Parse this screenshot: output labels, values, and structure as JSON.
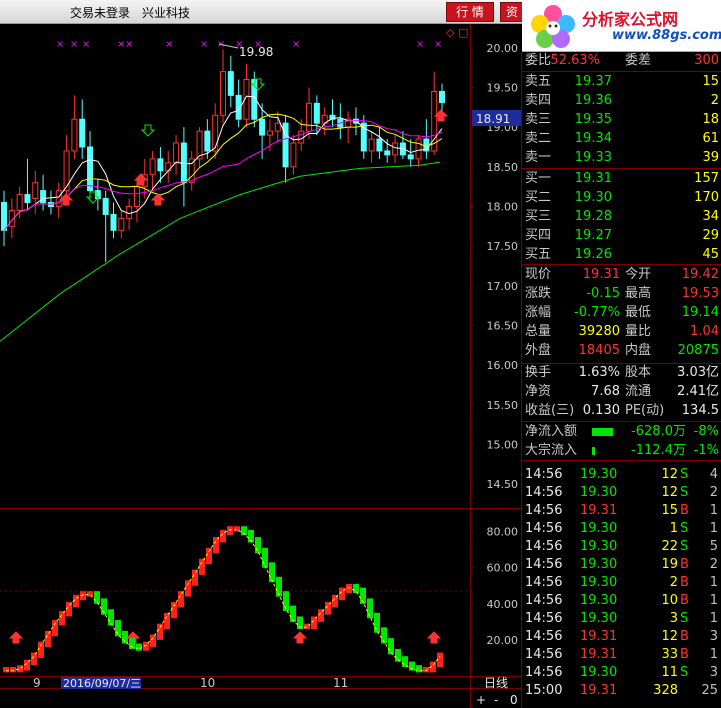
{
  "titlebar": {
    "status": "交易未登录",
    "stock_name": "兴业科技",
    "btn_quote": "行 情",
    "btn_info": "资"
  },
  "logo": {
    "brand": "分析家公式网",
    "url": "www.88gs.com"
  },
  "price_panel": {
    "max_label": "19.98",
    "current_label": "18.91",
    "axis_labels": [
      "20.00",
      "19.50",
      "19.00",
      "18.50",
      "18.00",
      "17.50",
      "17.00",
      "16.50",
      "16.00",
      "15.50",
      "15.00",
      "14.50"
    ],
    "axis_values": [
      20.0,
      19.5,
      19.0,
      18.5,
      18.0,
      17.5,
      17.0,
      16.5,
      16.0,
      15.5,
      15.0,
      14.5
    ]
  },
  "indicator_panel": {
    "axis_labels": [
      "80.00",
      "60.00",
      "40.00",
      "20.00"
    ],
    "axis_values": [
      80,
      60,
      40,
      20
    ]
  },
  "time_axis": {
    "labels": [
      "9",
      "10",
      "11"
    ],
    "cursor_date": "2016/09/07/三",
    "period": "日线",
    "zoom_in": "+",
    "zoom_out": "-",
    "zero": "0"
  },
  "quote": {
    "ratio_label": "委比",
    "ratio_value": "52.63%",
    "diff_label": "委差",
    "diff_value": "300",
    "sell": [
      {
        "label": "卖五",
        "price": "19.37",
        "vol": "15"
      },
      {
        "label": "卖四",
        "price": "19.36",
        "vol": "2"
      },
      {
        "label": "卖三",
        "price": "19.35",
        "vol": "18"
      },
      {
        "label": "卖二",
        "price": "19.34",
        "vol": "61"
      },
      {
        "label": "卖一",
        "price": "19.33",
        "vol": "39"
      }
    ],
    "buy": [
      {
        "label": "买一",
        "price": "19.31",
        "vol": "157"
      },
      {
        "label": "买二",
        "price": "19.30",
        "vol": "170"
      },
      {
        "label": "买三",
        "price": "19.28",
        "vol": "34"
      },
      {
        "label": "买四",
        "price": "19.27",
        "vol": "29"
      },
      {
        "label": "买五",
        "price": "19.26",
        "vol": "45"
      }
    ],
    "stats": [
      {
        "l1": "现价",
        "v1": "19.31",
        "c1": "red",
        "l2": "今开",
        "v2": "19.42",
        "c2": "red"
      },
      {
        "l1": "涨跌",
        "v1": "-0.15",
        "c1": "green",
        "l2": "最高",
        "v2": "19.53",
        "c2": "red"
      },
      {
        "l1": "涨幅",
        "v1": "-0.77%",
        "c1": "green",
        "l2": "最低",
        "v2": "19.14",
        "c2": "green"
      },
      {
        "l1": "总量",
        "v1": "39280",
        "c1": "yellow",
        "l2": "量比",
        "v2": "1.04",
        "c2": "red"
      },
      {
        "l1": "外盘",
        "v1": "18405",
        "c1": "red",
        "l2": "内盘",
        "v2": "20875",
        "c2": "green"
      }
    ],
    "fund": [
      {
        "l1": "换手",
        "v1": "1.63%",
        "l2": "股本",
        "v2": "3.03亿"
      },
      {
        "l1": "净资",
        "v1": "7.68",
        "l2": "流通",
        "v2": "2.41亿"
      },
      {
        "l1": "收益(三)",
        "v1": "0.130",
        "l2": "PE(动)",
        "v2": "134.5"
      }
    ],
    "flow": [
      {
        "label": "净流入额",
        "value": "-628.0万",
        "pct": "-8%",
        "bar": 0.8
      },
      {
        "label": "大宗流入",
        "value": "-112.4万",
        "pct": "-1%",
        "bar": 0.1
      }
    ]
  },
  "ticks": [
    {
      "time": "14:56",
      "price": "19.30",
      "vol": "12",
      "side": "S",
      "n": "4"
    },
    {
      "time": "14:56",
      "price": "19.30",
      "vol": "12",
      "side": "S",
      "n": "2"
    },
    {
      "time": "14:56",
      "price": "19.31",
      "vol": "15",
      "side": "B",
      "n": "1"
    },
    {
      "time": "14:56",
      "price": "19.30",
      "vol": "1",
      "side": "S",
      "n": "1"
    },
    {
      "time": "14:56",
      "price": "19.30",
      "vol": "22",
      "side": "S",
      "n": "5"
    },
    {
      "time": "14:56",
      "price": "19.30",
      "vol": "19",
      "side": "B",
      "n": "2"
    },
    {
      "time": "14:56",
      "price": "19.30",
      "vol": "2",
      "side": "B",
      "n": "1"
    },
    {
      "time": "14:56",
      "price": "19.30",
      "vol": "10",
      "side": "B",
      "n": "1"
    },
    {
      "time": "14:56",
      "price": "19.30",
      "vol": "3",
      "side": "S",
      "n": "1"
    },
    {
      "time": "14:56",
      "price": "19.31",
      "vol": "12",
      "side": "B",
      "n": "3"
    },
    {
      "time": "14:56",
      "price": "19.31",
      "vol": "33",
      "side": "B",
      "n": "1"
    },
    {
      "time": "14:56",
      "price": "19.30",
      "vol": "11",
      "side": "S",
      "n": "3"
    },
    {
      "time": "15:00",
      "price": "19.31",
      "vol": "328",
      "side": "",
      "n": "25"
    }
  ],
  "colors": {
    "up": "#ff3232",
    "down": "#54ffff",
    "ma_white": "#ffffff",
    "ma_yellow": "#ffff00",
    "ma_magenta": "#ff00ff",
    "ma_green": "#00e600",
    "grid": "#7a0000",
    "axis_text": "#c8c8c8"
  },
  "chart_data": {
    "type": "candlestick",
    "candles": [
      {
        "o": 18.05,
        "h": 18.2,
        "l": 17.5,
        "c": 17.7
      },
      {
        "o": 17.75,
        "h": 18.1,
        "l": 17.6,
        "c": 17.95
      },
      {
        "o": 17.95,
        "h": 18.25,
        "l": 17.85,
        "c": 18.15
      },
      {
        "o": 18.15,
        "h": 18.6,
        "l": 17.95,
        "c": 18.05
      },
      {
        "o": 18.1,
        "h": 18.45,
        "l": 17.9,
        "c": 18.3
      },
      {
        "o": 18.2,
        "h": 18.4,
        "l": 17.95,
        "c": 18.05
      },
      {
        "o": 18.05,
        "h": 18.2,
        "l": 17.9,
        "c": 18.0
      },
      {
        "o": 18.0,
        "h": 18.3,
        "l": 17.85,
        "c": 18.2
      },
      {
        "o": 18.2,
        "h": 18.9,
        "l": 18.1,
        "c": 18.7
      },
      {
        "o": 18.7,
        "h": 19.4,
        "l": 18.6,
        "c": 19.1
      },
      {
        "o": 19.1,
        "h": 19.35,
        "l": 18.6,
        "c": 18.75
      },
      {
        "o": 18.75,
        "h": 18.95,
        "l": 18.1,
        "c": 18.2
      },
      {
        "o": 18.2,
        "h": 18.35,
        "l": 17.95,
        "c": 18.1
      },
      {
        "o": 18.1,
        "h": 18.2,
        "l": 17.3,
        "c": 17.9
      },
      {
        "o": 17.9,
        "h": 18.05,
        "l": 17.6,
        "c": 17.7
      },
      {
        "o": 17.7,
        "h": 17.95,
        "l": 17.6,
        "c": 17.85
      },
      {
        "o": 17.85,
        "h": 18.1,
        "l": 17.7,
        "c": 18.0
      },
      {
        "o": 18.0,
        "h": 18.35,
        "l": 17.8,
        "c": 18.25
      },
      {
        "o": 18.25,
        "h": 18.6,
        "l": 18.1,
        "c": 18.4
      },
      {
        "o": 18.4,
        "h": 18.7,
        "l": 18.2,
        "c": 18.6
      },
      {
        "o": 18.6,
        "h": 18.75,
        "l": 18.3,
        "c": 18.45
      },
      {
        "o": 18.45,
        "h": 18.7,
        "l": 18.3,
        "c": 18.55
      },
      {
        "o": 18.55,
        "h": 18.9,
        "l": 18.4,
        "c": 18.8
      },
      {
        "o": 18.8,
        "h": 19.0,
        "l": 18.0,
        "c": 18.3
      },
      {
        "o": 18.3,
        "h": 18.7,
        "l": 18.2,
        "c": 18.6
      },
      {
        "o": 18.6,
        "h": 19.0,
        "l": 18.5,
        "c": 18.95
      },
      {
        "o": 18.95,
        "h": 19.1,
        "l": 18.6,
        "c": 18.7
      },
      {
        "o": 18.7,
        "h": 19.3,
        "l": 18.6,
        "c": 19.15
      },
      {
        "o": 19.15,
        "h": 19.98,
        "l": 19.05,
        "c": 19.7
      },
      {
        "o": 19.7,
        "h": 19.9,
        "l": 19.25,
        "c": 19.4
      },
      {
        "o": 19.4,
        "h": 19.6,
        "l": 19.0,
        "c": 19.1
      },
      {
        "o": 19.1,
        "h": 19.8,
        "l": 19.0,
        "c": 19.6
      },
      {
        "o": 19.6,
        "h": 19.7,
        "l": 19.0,
        "c": 19.1
      },
      {
        "o": 19.1,
        "h": 19.3,
        "l": 18.6,
        "c": 18.9
      },
      {
        "o": 18.9,
        "h": 19.1,
        "l": 18.7,
        "c": 18.95
      },
      {
        "o": 18.95,
        "h": 19.2,
        "l": 18.8,
        "c": 19.05
      },
      {
        "o": 19.05,
        "h": 19.15,
        "l": 18.3,
        "c": 18.5
      },
      {
        "o": 18.5,
        "h": 18.9,
        "l": 18.4,
        "c": 18.8
      },
      {
        "o": 18.8,
        "h": 19.1,
        "l": 18.7,
        "c": 18.95
      },
      {
        "o": 18.95,
        "h": 19.5,
        "l": 18.85,
        "c": 19.3
      },
      {
        "o": 19.3,
        "h": 19.4,
        "l": 18.9,
        "c": 19.05
      },
      {
        "o": 19.05,
        "h": 19.25,
        "l": 18.9,
        "c": 19.15
      },
      {
        "o": 19.15,
        "h": 19.35,
        "l": 19.0,
        "c": 19.1
      },
      {
        "o": 19.1,
        "h": 19.3,
        "l": 18.85,
        "c": 19.0
      },
      {
        "o": 19.0,
        "h": 19.2,
        "l": 18.8,
        "c": 19.1
      },
      {
        "o": 19.1,
        "h": 19.25,
        "l": 18.9,
        "c": 19.05
      },
      {
        "o": 19.05,
        "h": 19.15,
        "l": 18.6,
        "c": 18.7
      },
      {
        "o": 18.7,
        "h": 18.95,
        "l": 18.55,
        "c": 18.85
      },
      {
        "o": 18.85,
        "h": 19.0,
        "l": 18.6,
        "c": 18.7
      },
      {
        "o": 18.7,
        "h": 18.85,
        "l": 18.55,
        "c": 18.65
      },
      {
        "o": 18.65,
        "h": 18.9,
        "l": 18.55,
        "c": 18.8
      },
      {
        "o": 18.8,
        "h": 18.95,
        "l": 18.6,
        "c": 18.65
      },
      {
        "o": 18.65,
        "h": 18.85,
        "l": 18.5,
        "c": 18.6
      },
      {
        "o": 18.6,
        "h": 18.9,
        "l": 18.5,
        "c": 18.85
      },
      {
        "o": 18.85,
        "h": 19.1,
        "l": 18.6,
        "c": 18.7
      },
      {
        "o": 18.7,
        "h": 19.7,
        "l": 18.65,
        "c": 19.45
      },
      {
        "o": 19.45,
        "h": 19.55,
        "l": 19.14,
        "c": 19.31
      }
    ],
    "indicator": [
      2,
      2,
      3,
      6,
      10,
      16,
      22,
      28,
      33,
      38,
      42,
      44,
      44,
      40,
      34,
      28,
      22,
      18,
      15,
      14,
      16,
      20,
      26,
      32,
      38,
      44,
      50,
      56,
      62,
      68,
      74,
      78,
      80,
      80,
      78,
      74,
      68,
      60,
      52,
      44,
      36,
      30,
      26,
      26,
      30,
      34,
      38,
      42,
      46,
      48,
      46,
      40,
      32,
      24,
      18,
      12,
      8,
      5,
      3,
      2,
      2,
      5,
      10
    ],
    "ylim": [
      14.2,
      20.3
    ],
    "indicator_ylim": [
      0,
      92
    ]
  }
}
